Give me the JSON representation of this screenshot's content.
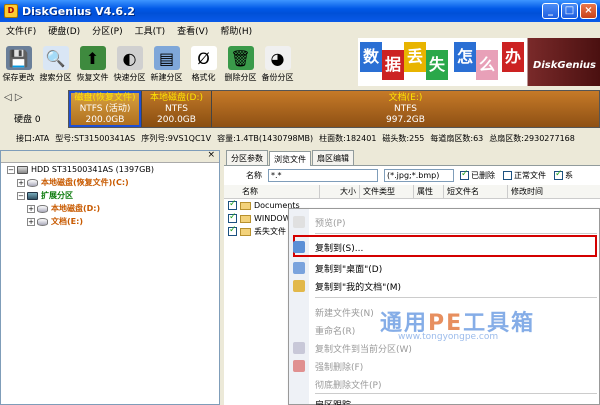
{
  "window": {
    "title": "DiskGenius V4.6.2",
    "min": "_",
    "max": "□",
    "close": "×"
  },
  "menu": [
    "文件(F)",
    "硬盘(D)",
    "分区(P)",
    "工具(T)",
    "查看(V)",
    "帮助(H)"
  ],
  "toolbar": [
    {
      "label": "保存更改",
      "icon": "save-icon",
      "color": "#6a7f99",
      "glyph": "💾"
    },
    {
      "label": "搜索分区",
      "icon": "search-icon",
      "color": "#d9e6f5",
      "glyph": "🔍"
    },
    {
      "label": "恢复文件",
      "icon": "recover-icon",
      "color": "#3e8a3e",
      "glyph": "⬆"
    },
    {
      "label": "快速分区",
      "icon": "quick-partition-icon",
      "color": "#d0d0d0",
      "glyph": "◐"
    },
    {
      "label": "新建分区",
      "icon": "new-partition-icon",
      "color": "#7fa7d9",
      "glyph": "▤"
    },
    {
      "label": "格式化",
      "icon": "format-icon",
      "color": "#ffffff",
      "glyph": "Ø"
    },
    {
      "label": "删除分区",
      "icon": "delete-partition-icon",
      "color": "#3a9a4a",
      "glyph": "🗑"
    },
    {
      "label": "备份分区",
      "icon": "backup-partition-icon",
      "color": "#f0f0f0",
      "glyph": "◕"
    }
  ],
  "banner": {
    "chars": [
      {
        "ch": "数",
        "color": "#2a6fd4"
      },
      {
        "ch": "据",
        "color": "#cc2222"
      },
      {
        "ch": "丢",
        "color": "#e8b400"
      },
      {
        "ch": "失",
        "color": "#2aa84a"
      },
      {
        "ch": "怎",
        "color": "#2a6fd4"
      },
      {
        "ch": "么",
        "color": "#e8a0b8"
      },
      {
        "ch": "办",
        "color": "#cc2222"
      }
    ],
    "brand": "DiskGenius"
  },
  "disk": {
    "nav": "◁ ▷",
    "label": "硬盘 0",
    "partitions": [
      {
        "name": "磁盘(恢复文件)",
        "fs": "NTFS (活动)",
        "size": "200.0GB"
      },
      {
        "name": "本地磁盘(D:)",
        "fs": "NTFS",
        "size": "200.0GB"
      },
      {
        "name": "文档(E:)",
        "fs": "NTFS",
        "size": "997.2GB"
      }
    ],
    "info": [
      "接口:ATA",
      "型号:ST31500341AS",
      "序列号:9VS1QC1V",
      "容量:1.4TB(1430798MB)",
      "柱面数:182401",
      "磁头数:255",
      "每道扇区数:63",
      "总扇区数:2930277168"
    ]
  },
  "tree": {
    "close": "×",
    "rows": [
      {
        "text": "HDD ST31500341AS (1397GB)",
        "level": 0,
        "tog": "−",
        "icon": "hdd",
        "style": ""
      },
      {
        "text": "本地磁盘(恢复文件)(C:)",
        "level": 1,
        "tog": "+",
        "icon": "part",
        "style": "orange"
      },
      {
        "text": "扩展分区",
        "level": 1,
        "tog": "−",
        "icon": "ext",
        "style": "green"
      },
      {
        "text": "本地磁盘(D:)",
        "level": 2,
        "tog": "+",
        "icon": "part",
        "style": "orange"
      },
      {
        "text": "文档(E:)",
        "level": 2,
        "tog": "+",
        "icon": "part",
        "style": "orange"
      }
    ]
  },
  "tabs": [
    "分区参数",
    "浏览文件",
    "扇区编辑"
  ],
  "filter": {
    "name_label": "名称",
    "name_value": "*.*",
    "ext_value": "(*.jpg;*.bmp)",
    "checks": [
      {
        "label": "已删除",
        "on": true
      },
      {
        "label": "正常文件",
        "on": false
      },
      {
        "label": "系",
        "on": true
      }
    ]
  },
  "columns": [
    "名称",
    "大小",
    "文件类型",
    "属性",
    "短文件名",
    "修改时间"
  ],
  "files": [
    {
      "name": "Documents",
      "checked": true
    },
    {
      "name": "WINDOWS",
      "checked": true
    },
    {
      "name": "丢失文件",
      "checked": true
    }
  ],
  "context_menu": [
    {
      "label": "预览(P)",
      "disabled": true,
      "icon": "preview-icon",
      "color": "#e0e0e0"
    },
    {
      "label": "复制到(S)...",
      "disabled": false,
      "icon": "copy-to-icon",
      "color": "#5b8fd6"
    },
    {
      "label": "复制到\"桌面\"(D)",
      "disabled": false,
      "icon": "copy-desktop-icon",
      "color": "#7aa3dd"
    },
    {
      "label": "复制到\"我的文档\"(M)",
      "disabled": false,
      "icon": "copy-documents-icon",
      "color": "#e2b84a"
    },
    {
      "label": "新建文件夹(N)",
      "disabled": true,
      "icon": "",
      "color": ""
    },
    {
      "label": "重命名(R)",
      "disabled": true,
      "icon": "",
      "color": ""
    },
    {
      "label": "复制文件到当前分区(W)",
      "disabled": true,
      "icon": "copy-partition-icon",
      "color": "#c8c8d8"
    },
    {
      "label": "强制删除(F)",
      "disabled": true,
      "icon": "force-delete-icon",
      "color": "#e09090"
    },
    {
      "label": "彻底删除文件(P)",
      "disabled": true,
      "icon": "",
      "color": ""
    },
    {
      "label": "扇区跟踪",
      "disabled": false,
      "icon": "",
      "color": ""
    }
  ],
  "watermark": {
    "text_a": "通用",
    "text_pe": "PE",
    "text_b": "工具箱",
    "sub": "www.tongyongpe.com"
  }
}
